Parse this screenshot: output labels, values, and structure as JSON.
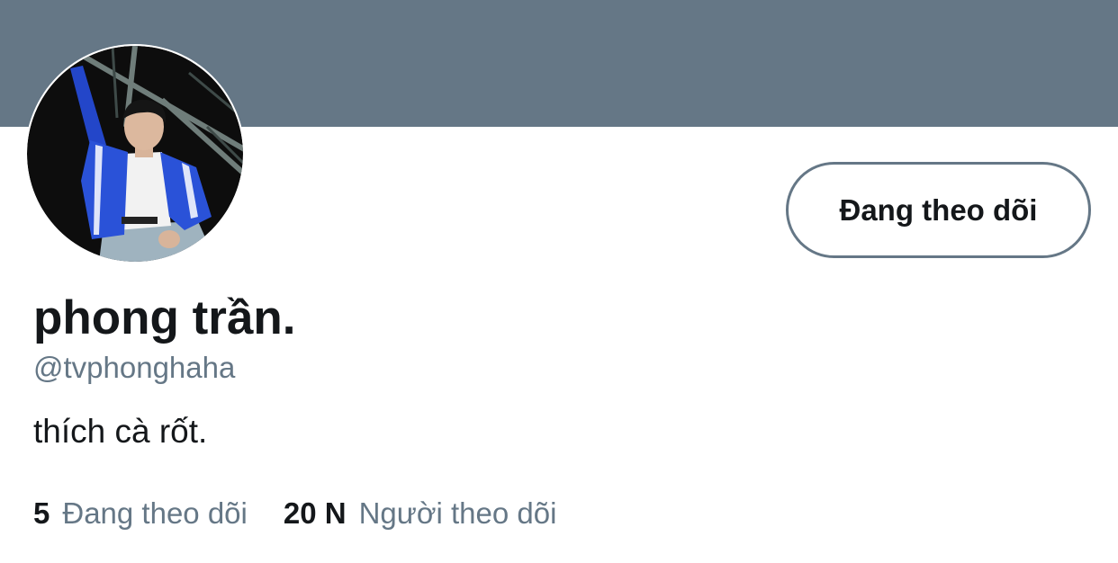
{
  "profile": {
    "display_name": "phong trần.",
    "handle": "@tvphonghaha",
    "bio": "thích cà rốt.",
    "follow_button_label": "Đang theo dõi"
  },
  "stats": [
    {
      "count": "5",
      "label": "Đang theo dõi"
    },
    {
      "count": "20 N",
      "label": "Người theo dõi"
    }
  ],
  "colors": {
    "banner": "#657786",
    "text_primary": "#14171a",
    "text_secondary": "#657786"
  }
}
